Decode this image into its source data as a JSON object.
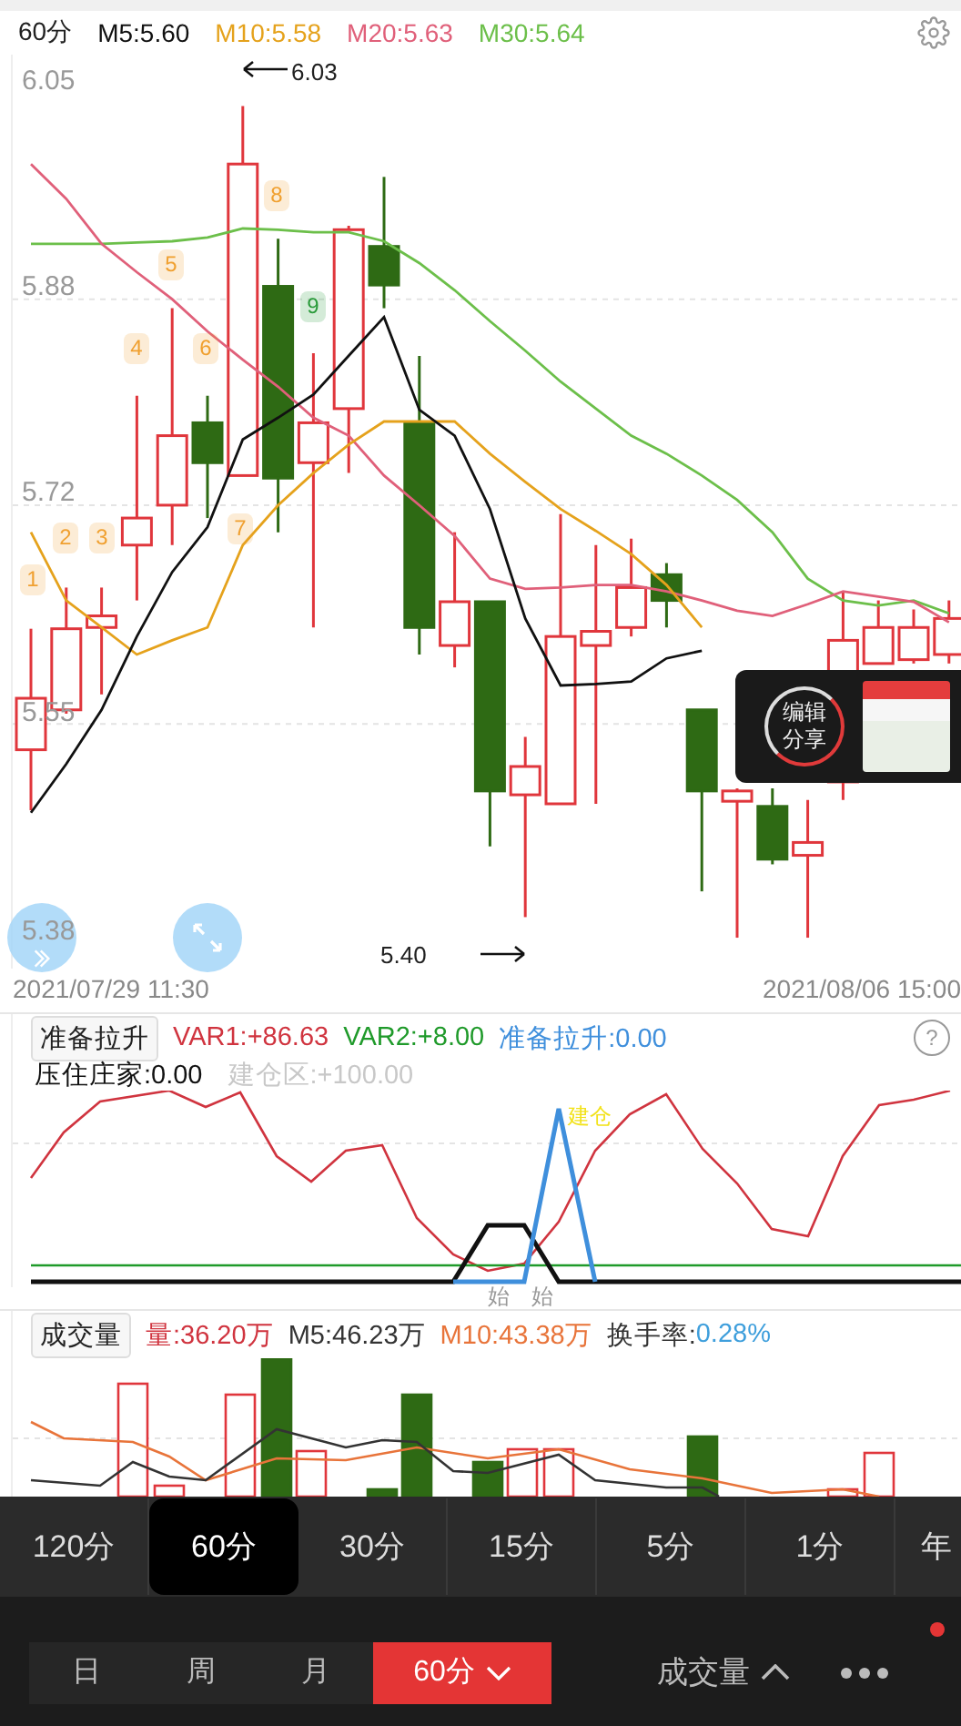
{
  "header": {
    "period": "60分"
  },
  "price_chart": {
    "candles": {
      "chart_data": {
        "type": "candlestick",
        "ylim": [
          5.36,
          6.07
        ],
        "yticks": [
          6.05,
          5.88,
          5.72,
          5.55,
          5.38
        ],
        "grid": true,
        "ohlc": [
          [
            5.53,
            5.624,
            5.483,
            5.57
          ],
          [
            5.561,
            5.656,
            5.558,
            5.624
          ],
          [
            5.625,
            5.656,
            5.573,
            5.634
          ],
          [
            5.689,
            5.805,
            5.646,
            5.71
          ],
          [
            5.72,
            5.873,
            5.689,
            5.774
          ],
          [
            5.784,
            5.805,
            5.71,
            5.753
          ],
          [
            5.743,
            6.03,
            5.743,
            5.985
          ],
          [
            5.89,
            5.927,
            5.699,
            5.741
          ],
          [
            5.753,
            5.838,
            5.625,
            5.784
          ],
          [
            5.795,
            5.937,
            5.745,
            5.934
          ],
          [
            5.921,
            5.975,
            5.873,
            5.891
          ],
          [
            5.784,
            5.836,
            5.604,
            5.625
          ],
          [
            5.611,
            5.699,
            5.594,
            5.645
          ],
          [
            5.645,
            5.645,
            5.455,
            5.498
          ],
          [
            5.495,
            5.54,
            5.4,
            5.517
          ],
          [
            5.488,
            5.713,
            5.488,
            5.618
          ],
          [
            5.611,
            5.689,
            5.488,
            5.622
          ],
          [
            5.625,
            5.694,
            5.618,
            5.656
          ],
          [
            5.666,
            5.675,
            5.625,
            5.646
          ],
          [
            5.561,
            5.561,
            5.42,
            5.498
          ],
          [
            5.49,
            5.5,
            5.384,
            5.498
          ],
          [
            5.486,
            5.5,
            5.441,
            5.445
          ],
          [
            5.448,
            5.491,
            5.384,
            5.458
          ],
          [
            5.505,
            5.653,
            5.491,
            5.615
          ],
          [
            5.597,
            5.646,
            5.597,
            5.625
          ],
          [
            5.6,
            5.639,
            5.597,
            5.625
          ],
          [
            5.604,
            5.646,
            5.597,
            5.632
          ]
        ]
      }
    },
    "averages": {
      "chart_data": {
        "type": "line",
        "ylim": [
          5.36,
          6.07
        ],
        "series": [
          {
            "name": "M5:5.60",
            "color": "#111111",
            "values": [
              5.481,
              5.519,
              5.561,
              5.618,
              5.668,
              5.703,
              5.771,
              5.788,
              5.806,
              5.836,
              5.866,
              5.794,
              5.774,
              5.717,
              5.632,
              5.58,
              5.581,
              5.583,
              5.601,
              5.607,
              null,
              null,
              null,
              null,
              null,
              null,
              null
            ]
          },
          {
            "name": "M10:5.58",
            "color": "#e5a21c",
            "values": [
              5.699,
              5.646,
              5.625,
              5.604,
              5.615,
              5.625,
              5.689,
              5.72,
              5.745,
              5.767,
              5.785,
              5.785,
              5.785,
              5.76,
              5.738,
              5.717,
              5.7,
              5.682,
              5.658,
              5.625,
              null,
              null,
              null,
              null,
              null,
              null,
              null
            ]
          },
          {
            "name": "M20:5.63",
            "color": "#e0607a",
            "values": [
              5.985,
              5.958,
              5.923,
              5.901,
              5.88,
              5.855,
              5.833,
              5.812,
              5.788,
              5.774,
              5.743,
              5.72,
              5.696,
              5.663,
              5.655,
              5.656,
              5.658,
              5.658,
              5.653,
              5.646,
              5.638,
              5.634,
              5.643,
              5.653,
              5.649,
              5.645,
              5.629
            ]
          },
          {
            "name": "M30:5.64",
            "color": "#6cbf4a",
            "values": [
              5.923,
              5.923,
              5.923,
              5.924,
              5.925,
              5.928,
              5.935,
              5.934,
              5.932,
              5.932,
              5.925,
              5.908,
              5.887,
              5.863,
              5.84,
              5.816,
              5.795,
              5.774,
              5.76,
              5.743,
              5.724,
              5.699,
              5.663,
              5.646,
              5.642,
              5.646,
              5.636
            ]
          }
        ]
      }
    },
    "high_marker": "6.03",
    "low_marker": "5.40",
    "counters": [
      {
        "text": "1",
        "color": "#f0a030"
      },
      {
        "text": "2",
        "color": "#f0a030"
      },
      {
        "text": "3",
        "color": "#f0a030"
      },
      {
        "text": "4",
        "color": "#f0a030"
      },
      {
        "text": "5",
        "color": "#f0a030"
      },
      {
        "text": "6",
        "color": "#f0a030"
      },
      {
        "text": "7",
        "color": "#f0a030"
      },
      {
        "text": "8",
        "color": "#f0a030"
      },
      {
        "text": "9",
        "color": "#2a9a3a"
      }
    ],
    "share_popup": {
      "lines": [
        "编辑",
        "分享"
      ]
    },
    "date_start": "2021/07/29 11:30",
    "date_end": "2021/08/06 15:00"
  },
  "indicator": {
    "button": "准备拉升",
    "values": [
      {
        "text": "VAR1:+86.63",
        "color": "#d0343f"
      },
      {
        "text": "VAR2:+8.00",
        "color": "#1f9a2a"
      },
      {
        "text": "准备拉升:0.00",
        "color": "#3f8fdc"
      }
    ],
    "help_icon": "?",
    "values_row2": [
      {
        "text": "压住庄家:0.00",
        "color": "#111111"
      },
      {
        "text": "建仓区:+100.00",
        "color": "#c8c8c8"
      }
    ],
    "chart_labels": [
      {
        "text": "建仓",
        "color": "#f2e21a"
      },
      {
        "text": "始",
        "color": "#999999"
      },
      {
        "text": "始",
        "color": "#999999"
      }
    ]
  },
  "volume": {
    "button": "成交量",
    "values": [
      {
        "text": "量:36.20万",
        "color": "#d0343f"
      },
      {
        "text": "M5:46.23万",
        "color": "#333333"
      },
      {
        "text": "M10:43.38万",
        "color": "#e8743a"
      }
    ],
    "turnover_label": "换手率:",
    "turnover_value": "0.28%"
  },
  "period_tabs": [
    {
      "label": "120分",
      "selected": false
    },
    {
      "label": "60分",
      "selected": true
    },
    {
      "label": "30分",
      "selected": false
    },
    {
      "label": "15分",
      "selected": false
    },
    {
      "label": "5分",
      "selected": false
    },
    {
      "label": "1分",
      "selected": false
    },
    {
      "label": "年",
      "selected": false
    }
  ],
  "bottom_tabs": [
    {
      "label": "日",
      "selected": false
    },
    {
      "label": "周",
      "selected": false
    },
    {
      "label": "月",
      "selected": false
    },
    {
      "label": "60分",
      "selected": true
    }
  ],
  "indicator_menu": "成交量"
}
